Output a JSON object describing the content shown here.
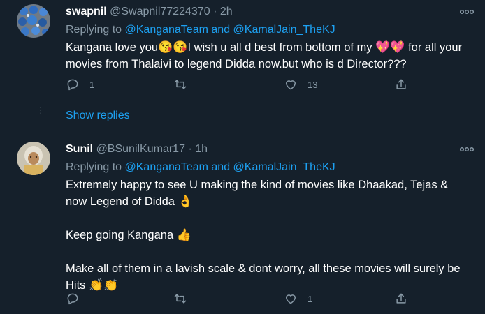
{
  "tweet1": {
    "name": "swapnil",
    "handle": "@Swapnil77224370",
    "time": "2h",
    "replying_to": "Replying to",
    "mention1": "@KanganaTeam",
    "and": "and",
    "mention2": "@KamalJain_TheKJ",
    "text_a": "Kangana love you",
    "emoji_kiss": "😘😘",
    "text_b": "I wish u all d best from bottom of my ",
    "emoji_hearts": "💖💖",
    "text_c": " for all your movies from Thalaivi to legend Didda now.but who is d Director???",
    "reply_count": "1",
    "retweet_count": "",
    "like_count": "13"
  },
  "show_replies": "Show replies",
  "tweet2": {
    "name": "Sunil",
    "handle": "@BSunilKumar17",
    "time": "1h",
    "replying_to": "Replying to",
    "mention1": "@KanganaTeam",
    "and": "and",
    "mention2": "@KamalJain_TheKJ",
    "para1": "Extremely happy to see U making the kind of movies like Dhaakad, Tejas & now Legend of Didda",
    "emoji_ok": "👌",
    "para2": "Keep going Kangana",
    "emoji_thumb": "👍",
    "para3": "Make all of them in a lavish scale & dont worry, all these movies will surely be Hits",
    "emoji_clap": "👏👏",
    "reply_count": "",
    "retweet_count": "",
    "like_count": "1"
  },
  "icons": {
    "reply": "reply-icon",
    "retweet": "retweet-icon",
    "like": "heart-icon",
    "share": "share-icon",
    "more": "more-icon"
  },
  "colors": {
    "background": "#15202b",
    "text": "#ffffff",
    "secondary": "#8899a6",
    "link": "#1da1f2",
    "divider": "#38444d"
  }
}
